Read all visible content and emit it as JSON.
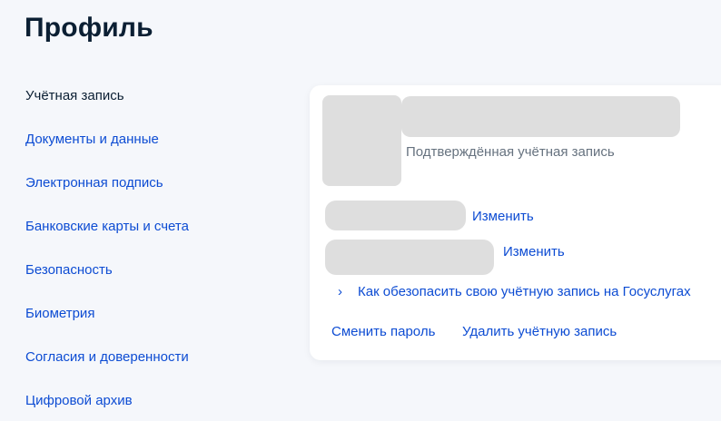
{
  "header": {
    "title": "Профиль"
  },
  "sidebar": {
    "items": [
      {
        "label": "Учётная запись",
        "active": true
      },
      {
        "label": "Документы и данные"
      },
      {
        "label": "Электронная подпись"
      },
      {
        "label": "Банковские карты и счета"
      },
      {
        "label": "Безопасность"
      },
      {
        "label": "Биометрия"
      },
      {
        "label": "Согласия и доверенности"
      },
      {
        "label": "Цифровой архив"
      }
    ]
  },
  "account": {
    "status": "Подтверждённая учётная запись",
    "change_label_1": "Изменить",
    "change_label_2": "Изменить",
    "secure_link": "Как обезопасить свою учётную запись на Госуслугах",
    "change_password": "Сменить пароль",
    "delete_account": "Удалить учётную запись"
  },
  "icons": {
    "expand": "chevron-right-icon"
  },
  "colors": {
    "link": "#0d4cd3",
    "title": "#0b1f33",
    "muted": "#66727f",
    "placeholder": "#dedede",
    "background": "#f5f7fb"
  }
}
